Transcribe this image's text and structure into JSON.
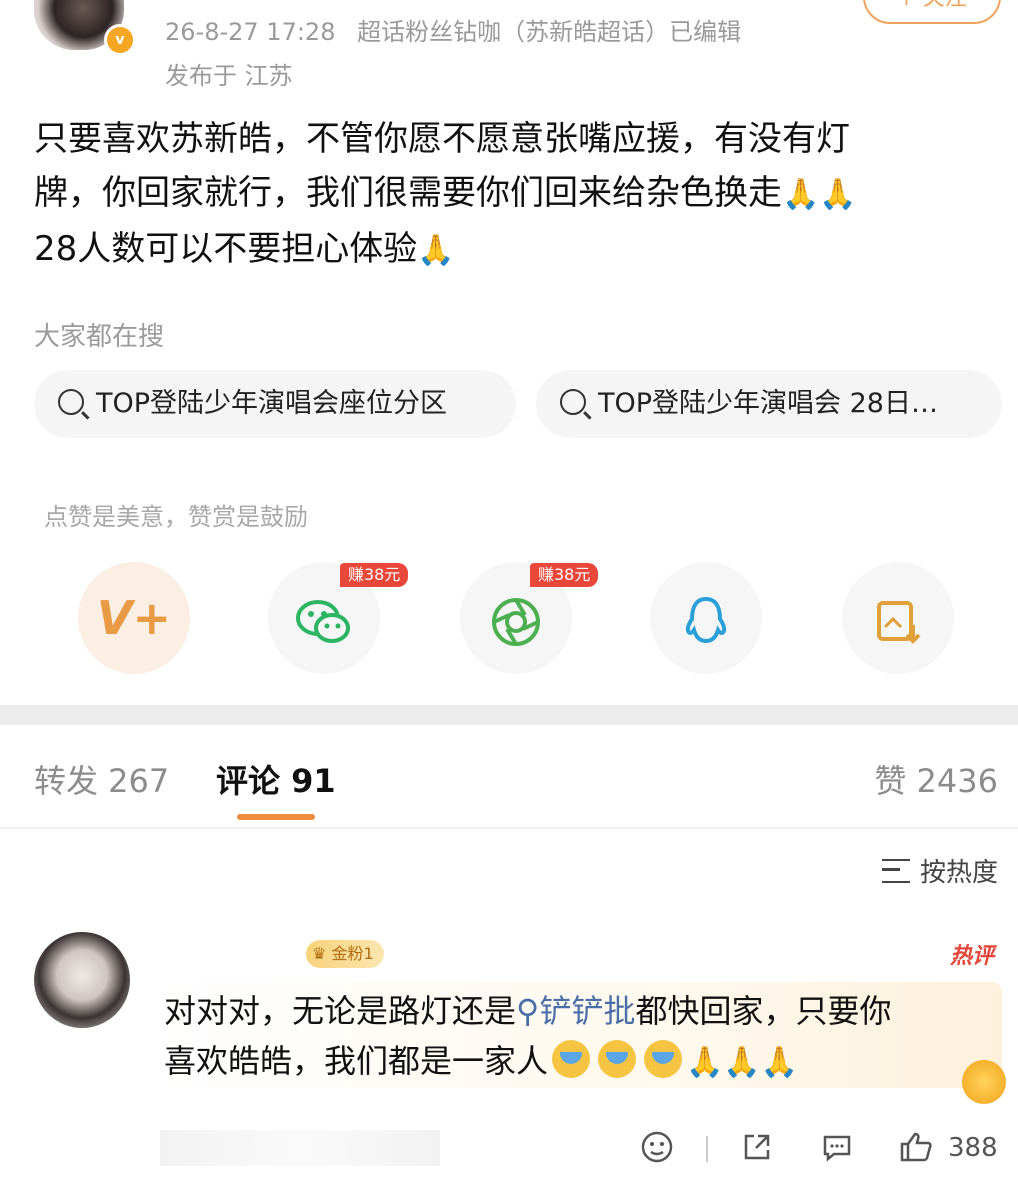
{
  "post": {
    "timestamp": "26-8-27 17:28",
    "source": "超话粉丝钻咖（苏新皓超话）已编辑",
    "location": "发布于 江苏",
    "follow_label": "+ 关注",
    "text_line1": "只要喜欢苏新皓，不管你愿不愿意张嘴应援，有没有灯",
    "text_line2": "牌，你回家就行，我们很需要你们回来给杂色换走",
    "text_line3": "28人数可以不要担心体验",
    "pray_emoji": "🙏"
  },
  "search": {
    "title": "大家都在搜",
    "chips": [
      "TOP登陆少年演唱会座位分区",
      "TOP登陆少年演唱会 28日…"
    ]
  },
  "share": {
    "tip": "点赞是美意，赞赏是鼓励",
    "earn_badge": "赚38元",
    "items": [
      "vip-icon",
      "wechat-icon",
      "moments-icon",
      "qq-icon",
      "save-image-icon"
    ]
  },
  "tabs": {
    "repost": "转发 267",
    "comment": "评论 91",
    "like": "赞 2436"
  },
  "sort_label": "按热度",
  "comment": {
    "fan_badge": "金粉1",
    "hot_tag": "热评",
    "text_a": "对对对，无论是路灯还是",
    "mention": "铲铲批",
    "text_b": "都快回家，只要你",
    "text_c": "喜欢皓皓，我们都是一家人",
    "like_count": "388"
  },
  "colors": {
    "accent": "#f08c3c",
    "hot": "#e2473a",
    "mention": "#4a6fa8"
  }
}
